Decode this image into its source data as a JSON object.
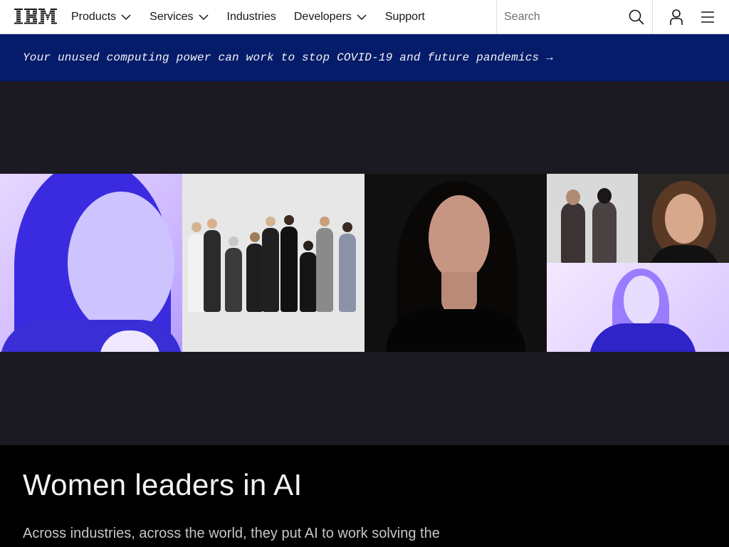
{
  "brand": {
    "logo_text": "IBM"
  },
  "nav": {
    "items": [
      {
        "label": "Products",
        "has_dropdown": true
      },
      {
        "label": "Services",
        "has_dropdown": true
      },
      {
        "label": "Industries",
        "has_dropdown": false
      },
      {
        "label": "Developers",
        "has_dropdown": true
      },
      {
        "label": "Support",
        "has_dropdown": false
      }
    ],
    "search_placeholder": "Search",
    "icons": [
      "search-icon",
      "user-icon",
      "hamburger-icon",
      "chevron-down-icon"
    ]
  },
  "banner": {
    "text": "Your unused computing power can work to stop COVID-19 and future pandemics →",
    "background": "#051c6a"
  },
  "hero": {
    "background": "#1b1a23"
  },
  "lead": {
    "title": "Women leaders in AI",
    "body": "Across industries, across the world, they put AI to work solving the biggest business challenges."
  },
  "colors": {
    "nav_bg": "#ffffff",
    "banner_bg": "#051c6a",
    "hero_bg": "#1b1a23",
    "lead_bg": "#000000",
    "accent_violet": "#3b2be0"
  }
}
